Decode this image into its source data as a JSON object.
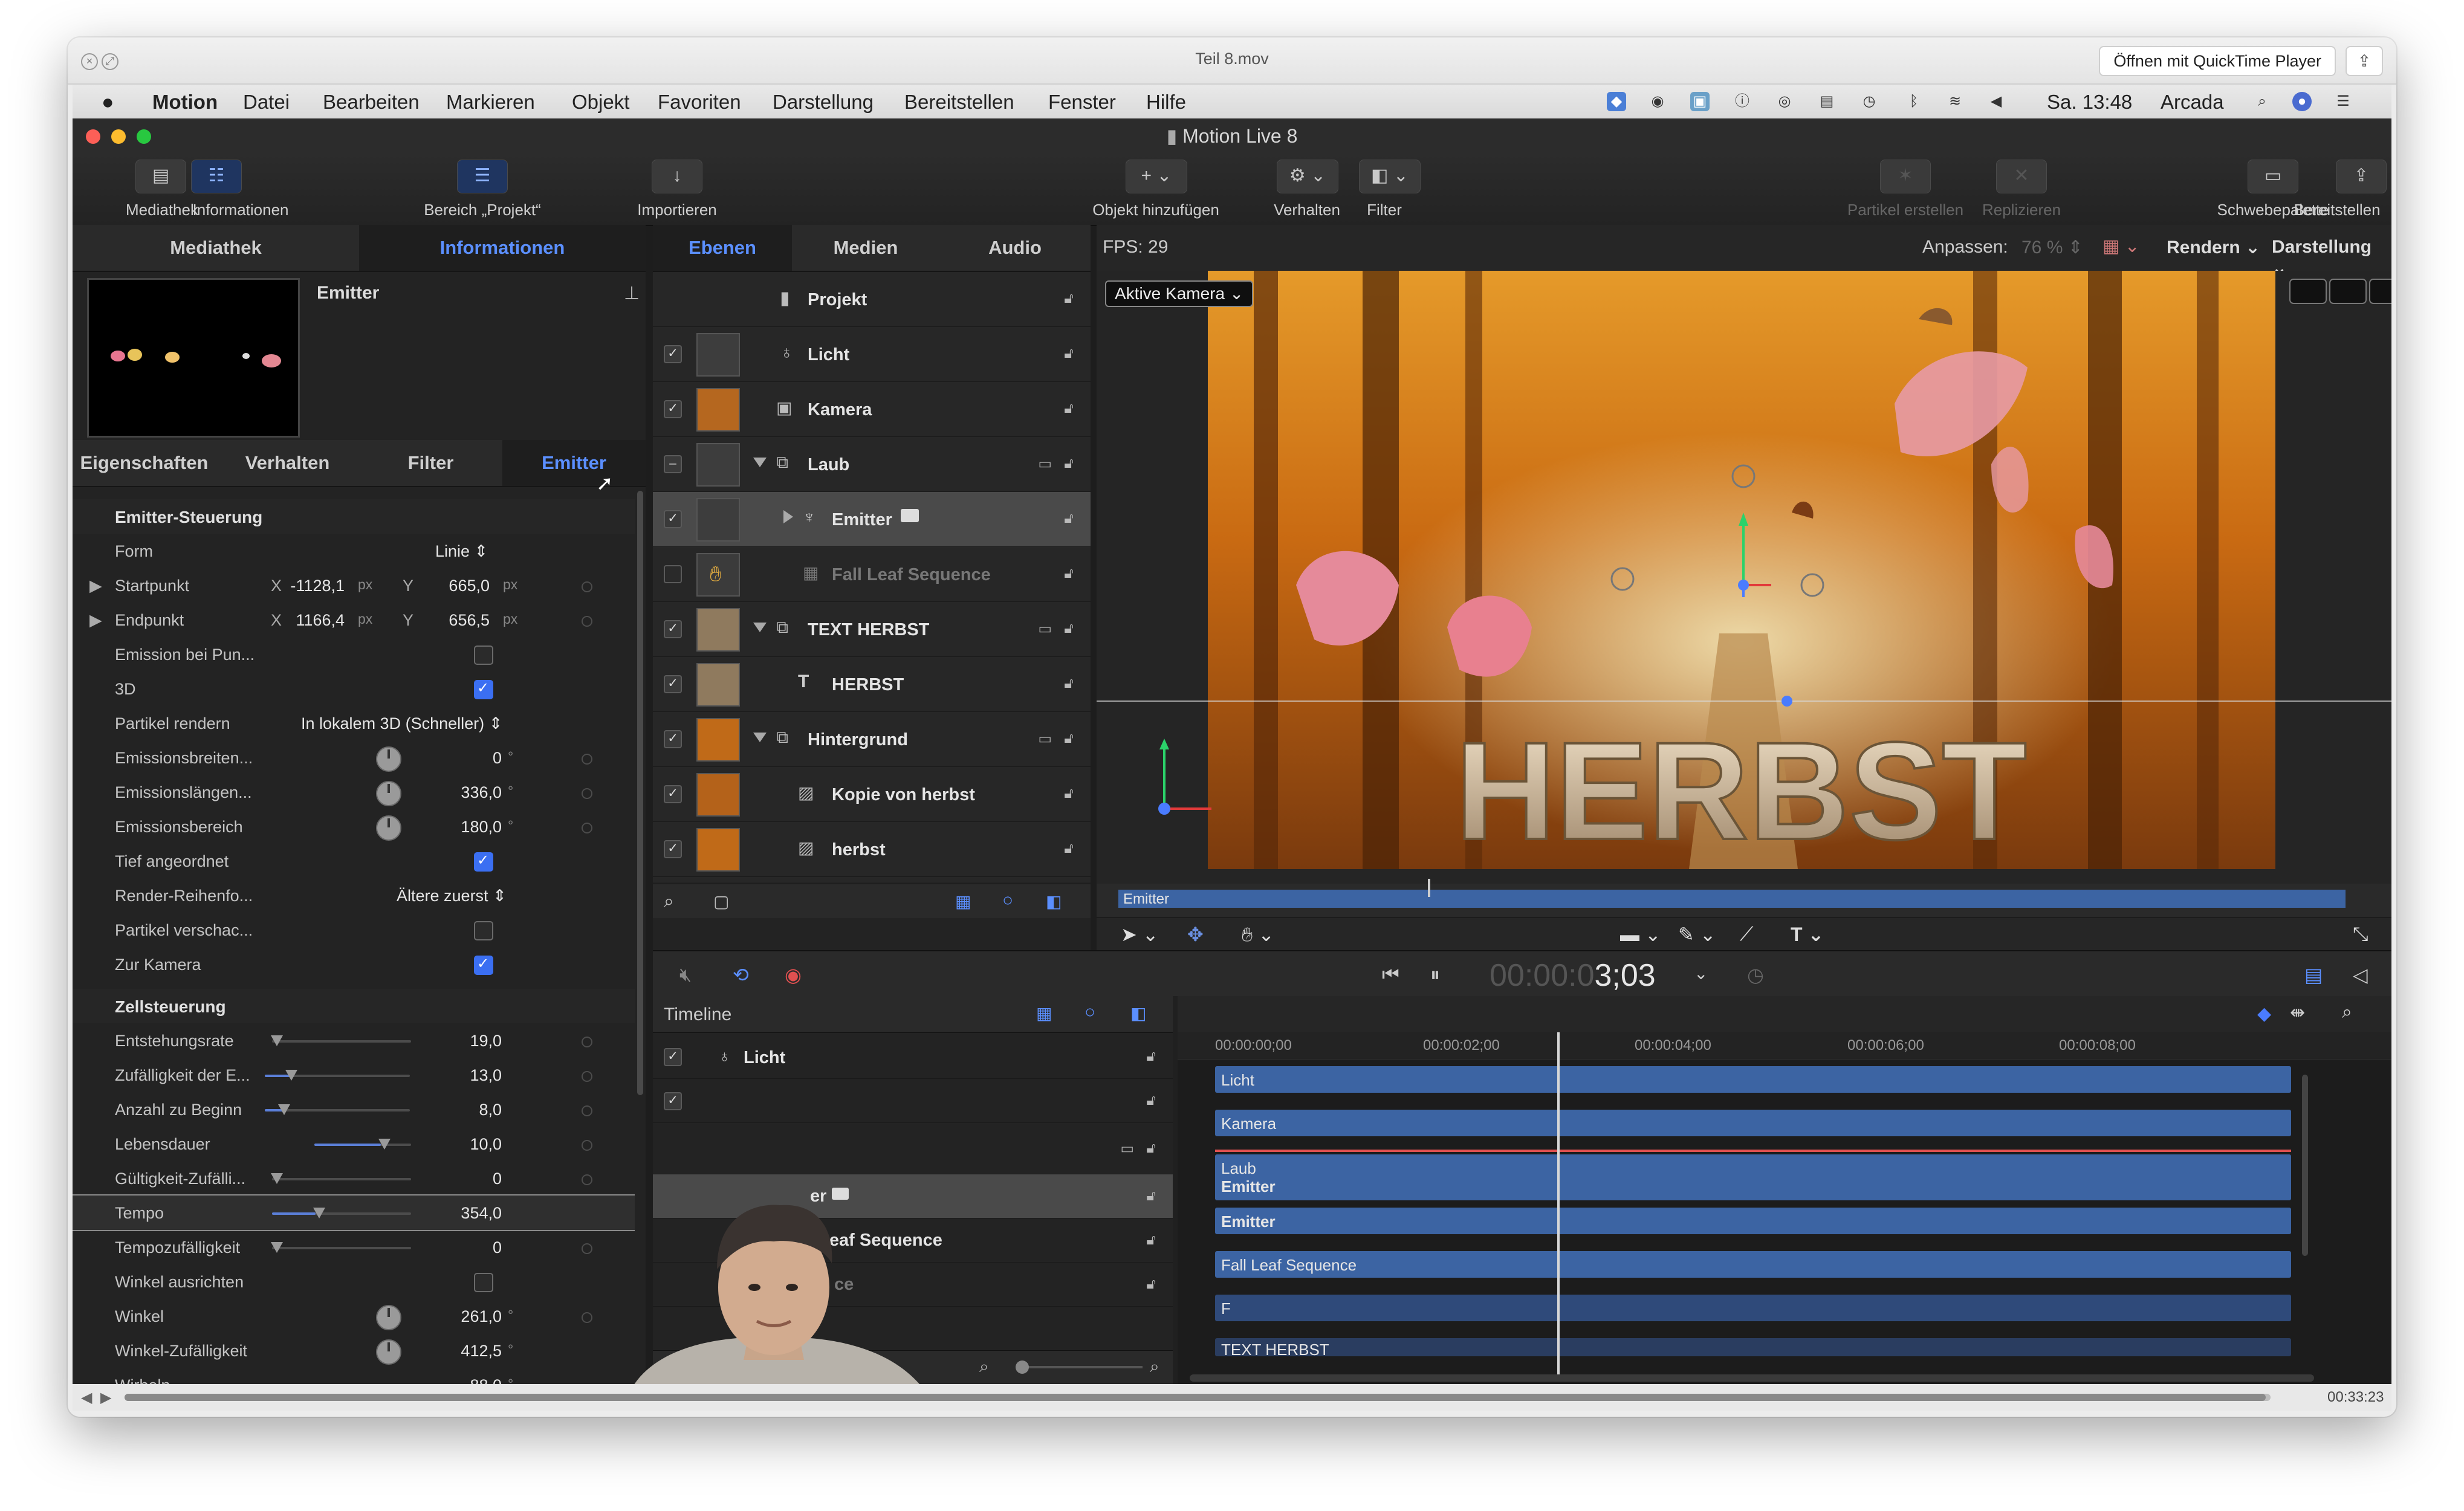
{
  "quicktime": {
    "title": "Teil 8.mov",
    "open_with_button": "Öffnen mit QuickTime Player",
    "elapsed": "00:33:23"
  },
  "menubar": {
    "app": "Motion",
    "items": [
      "Datei",
      "Bearbeiten",
      "Markieren",
      "Objekt",
      "Favoriten",
      "Darstellung",
      "Bereitstellen",
      "Fenster",
      "Hilfe"
    ],
    "clock": "Sa. 13:48",
    "user": "Arcada"
  },
  "document": {
    "title": "Motion Live 8"
  },
  "toolbar": {
    "library": "Mediathek",
    "inspector": "Informationen",
    "project_pane": "Bereich „Projekt“",
    "import": "Importieren",
    "add_object": "Objekt hinzufügen",
    "behaviors": "Verhalten",
    "filters": "Filter",
    "make_particles": "Partikel erstellen",
    "replicate": "Replizieren",
    "hud": "Schwebepalette",
    "share": "Bereitstellen"
  },
  "inspector": {
    "tabs_top": {
      "library": "Mediathek",
      "info": "Informationen"
    },
    "preview_title": "Emitter",
    "tabs": {
      "props": "Eigenschaften",
      "behaviors": "Verhalten",
      "filters": "Filter",
      "emitter": "Emitter"
    },
    "emitter_section": "Emitter-Steuerung",
    "shape_label": "Form",
    "shape_value": "Linie",
    "start_label": "Startpunkt",
    "start_x": "-1128,1",
    "start_y": "665,0",
    "end_label": "Endpunkt",
    "end_x": "1166,4",
    "end_y": "656,5",
    "x_label": "X",
    "y_label": "Y",
    "unit_px": "px",
    "emit_pts_label": "Emission bei Pun...",
    "three_d_label": "3D",
    "render_label": "Partikel rendern",
    "render_value": "In lokalem 3D (Schneller)",
    "em_width_label": "Emissionsbreiten...",
    "em_width_value": "0",
    "em_long_label": "Emissionslängen...",
    "em_long_value": "336,0",
    "em_range_label": "Emissionsbereich",
    "em_range_value": "180,0",
    "depth_label": "Tief angeordnet",
    "order_label": "Render-Reihenfo...",
    "order_value": "Ältere zuerst",
    "shade_label": "Partikel verschac...",
    "camera_label": "Zur Kamera",
    "degree": "°",
    "cell_section": "Zellsteuerung",
    "cell_rows": [
      {
        "label": "Entstehungsrate",
        "value": "19,0"
      },
      {
        "label": "Zufälligkeit der E...",
        "value": "13,0"
      },
      {
        "label": "Anzahl zu Beginn",
        "value": "8,0"
      },
      {
        "label": "Lebensdauer",
        "value": "10,0"
      },
      {
        "label": "Gültigkeit-Zufälli...",
        "value": "0"
      },
      {
        "label": "Tempo",
        "value": "354,0"
      },
      {
        "label": "Tempozufälligkeit",
        "value": "0"
      }
    ],
    "angle_align_label": "Winkel ausrichten",
    "angle_label": "Winkel",
    "angle_value": "261,0",
    "angle_rand_label": "Winkel-Zufälligkeit",
    "angle_rand_value": "412,5",
    "spin_label": "Wirbeln",
    "spin_value": "88,0"
  },
  "layers": {
    "tabs": {
      "layers": "Ebenen",
      "media": "Medien",
      "audio": "Audio"
    },
    "items": [
      {
        "name": "Projekt"
      },
      {
        "name": "Licht"
      },
      {
        "name": "Kamera"
      },
      {
        "name": "Laub"
      },
      {
        "name": "Emitter"
      },
      {
        "name": "Fall Leaf Sequence"
      },
      {
        "name": "TEXT HERBST"
      },
      {
        "name": "HERBST"
      },
      {
        "name": "Hintergrund"
      },
      {
        "name": "Kopie von herbst"
      },
      {
        "name": "herbst"
      }
    ]
  },
  "canvas": {
    "fps": "FPS: 29",
    "fit_label": "Anpassen:",
    "fit_value": "76 %",
    "render": "Rendern",
    "view": "Darstellung",
    "camera_menu": "Aktive Kamera",
    "headline": "HERBST",
    "mini_timeline_label": "Emitter"
  },
  "transport": {
    "timecode_dim": "00:00:0",
    "timecode": "3;03"
  },
  "timeline": {
    "title": "Timeline",
    "ruler": [
      "00:00:00;00",
      "00:00:02;00",
      "00:00:04;00",
      "00:00:06;00",
      "00:00:08;00"
    ],
    "layers": {
      "light": "Licht",
      "fall_leaf_partial": "ll Leaf Sequence",
      "emitter_partial": "er",
      "sequence_partial": "ce"
    },
    "bars": {
      "light": "Licht",
      "camera": "Kamera",
      "laub": "Laub",
      "emitter_a": "Emitter",
      "emitter_b": "Emitter",
      "fall_leaf": "Fall Leaf Sequence",
      "f": "F",
      "text_herbst": "TEXT HERBST"
    }
  },
  "colors": {
    "accent": "#5b8fff",
    "track": "#3c64a3",
    "panel": "#232323"
  }
}
